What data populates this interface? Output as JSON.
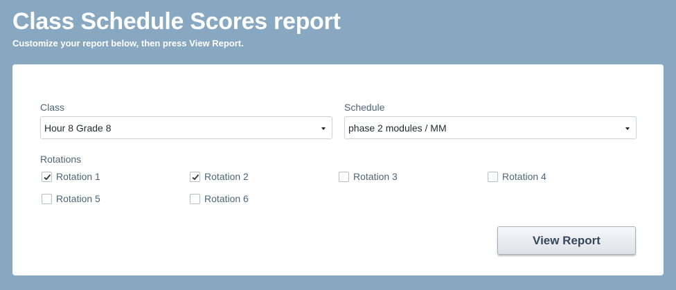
{
  "header": {
    "title": "Class Schedule Scores report",
    "subtitle": "Customize your report below, then press View Report."
  },
  "form": {
    "class": {
      "label": "Class",
      "value": "Hour 8 Grade 8"
    },
    "schedule": {
      "label": "Schedule",
      "value": "phase 2 modules / MM"
    },
    "rotations": {
      "label": "Rotations",
      "items": [
        {
          "label": "Rotation 1",
          "checked": true
        },
        {
          "label": "Rotation 2",
          "checked": true
        },
        {
          "label": "Rotation 3",
          "checked": false
        },
        {
          "label": "Rotation 4",
          "checked": false
        },
        {
          "label": "Rotation 5",
          "checked": false
        },
        {
          "label": "Rotation 6",
          "checked": false
        }
      ]
    },
    "submit_label": "View Report"
  },
  "colors": {
    "background": "#87a8c0",
    "panel": "#ffffff",
    "label_text": "#4d6478",
    "button_text": "#33475b"
  }
}
